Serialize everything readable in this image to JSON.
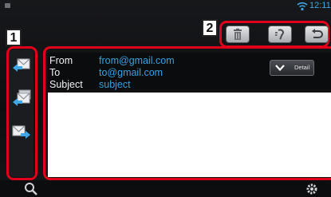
{
  "status": {
    "time": "12:11",
    "icons": [
      "status-square-icon",
      "wifi-icon"
    ]
  },
  "callouts": {
    "left_toolbar": "1",
    "top_toolbar": "2"
  },
  "left_toolbar": {
    "items": [
      {
        "name": "reply-icon"
      },
      {
        "name": "reply-all-icon"
      },
      {
        "name": "forward-icon"
      }
    ]
  },
  "top_toolbar": {
    "items": [
      {
        "name": "trash-icon"
      },
      {
        "name": "read-aloud-icon"
      },
      {
        "name": "back-icon"
      }
    ]
  },
  "message": {
    "from_label": "From",
    "from_value": "from@gmail.com",
    "to_label": "To",
    "to_value": "to@gmail.com",
    "subject_label": "Subject",
    "subject_value": "subject",
    "detail_label": "Detail",
    "body": ""
  },
  "bottom_bar": {
    "icons": [
      "search-icon",
      "settings-icon"
    ]
  },
  "colors": {
    "accent": "#34a3e3",
    "callout_border": "#e3001b",
    "clock": "#3fa7e6"
  }
}
